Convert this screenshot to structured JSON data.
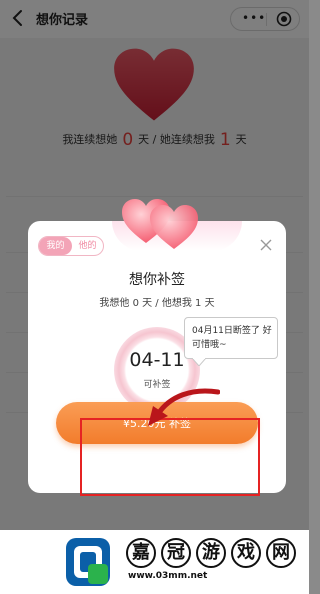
{
  "nav": {
    "title": "想你记录",
    "back_icon": "chevron-left-icon",
    "more_icon": "more-dots-icon",
    "close_icon": "target-icon"
  },
  "streak": {
    "prefix": "我连续想她",
    "me_days": "0",
    "middle": "天 / 她连续想我",
    "her_days": "1",
    "suffix": "天"
  },
  "modal": {
    "toggle_mine": "我的",
    "toggle_his": "他的",
    "title": "想你补签",
    "subtitle": "我想他 0 天 / 他想我 1 天",
    "date": "04-11",
    "date_status": "可补签",
    "tooltip": "04月11日断签了 好可惜哦~",
    "cta_label": "¥5.20元 补签",
    "close_icon": "close-icon"
  },
  "watermark": {
    "chars": [
      "嘉",
      "冠",
      "游",
      "戏",
      "网"
    ],
    "url": "www.03mm.net"
  },
  "colors": {
    "accent_red": "#e8413c",
    "cta_orange": "#f27c2c",
    "toggle_pink": "#f3a4b7",
    "annotation_red": "#e52323"
  }
}
